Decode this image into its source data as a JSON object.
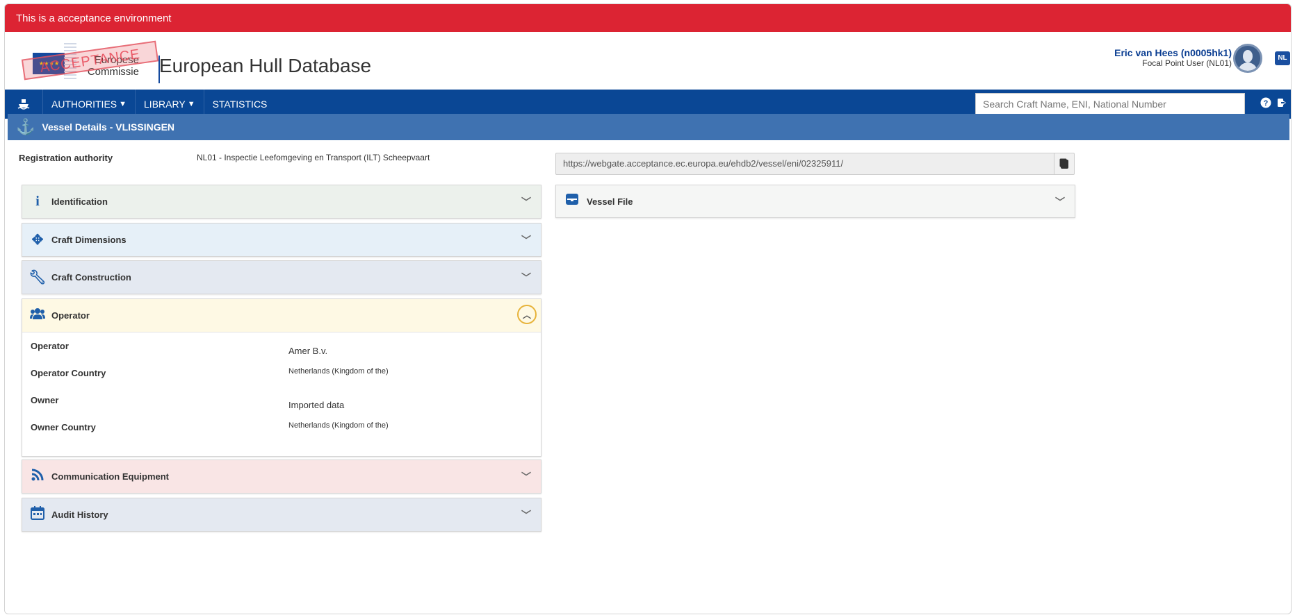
{
  "env_banner": "This is a acceptance environment",
  "header": {
    "logo_line1": "Europese",
    "logo_line2": "Commissie",
    "stamp": "ACCEPTANCE",
    "site_title": "European Hull Database",
    "user_name": "Eric van Hees (n0005hk1)",
    "user_role": "Focal Point User (NL01)",
    "lang": "NL"
  },
  "nav": {
    "home_icon": "ship-icon",
    "items": [
      {
        "label": "AUTHORITIES",
        "dropdown": true
      },
      {
        "label": "LIBRARY",
        "dropdown": true
      },
      {
        "label": "STATISTICS",
        "dropdown": false
      }
    ],
    "search_placeholder": "Search Craft Name, ENI, National Number",
    "help_icon": "help-icon",
    "logout_icon": "logout-icon"
  },
  "panel": {
    "title": "Vessel Details - VLISSINGEN",
    "icon": "anchor-icon"
  },
  "registration": {
    "label": "Registration authority",
    "value": "NL01 - Inspectie Leefomgeving en Transport (ILT) Scheepvaart"
  },
  "url": "https://webgate.acceptance.ec.europa.eu/ehdb2/vessel/eni/02325911/",
  "sections": {
    "identification": {
      "title": "Identification",
      "icon": "info-icon"
    },
    "dimensions": {
      "title": "Craft Dimensions",
      "icon": "arrows-icon"
    },
    "construction": {
      "title": "Craft Construction",
      "icon": "wrench-icon"
    },
    "operator": {
      "title": "Operator",
      "icon": "users-icon",
      "fields": [
        {
          "label": "Operator",
          "value": "Amer B.v."
        },
        {
          "label": "Operator Country",
          "value": "Netherlands (Kingdom of the)"
        },
        {
          "label": "Owner",
          "value": "Imported data"
        },
        {
          "label": "Owner Country",
          "value": "Netherlands (Kingdom of the)"
        }
      ]
    },
    "communication": {
      "title": "Communication Equipment",
      "icon": "rss-icon"
    },
    "audit": {
      "title": "Audit History",
      "icon": "calendar-icon"
    },
    "vessel_file": {
      "title": "Vessel File",
      "icon": "folder-icon"
    }
  },
  "colors": {
    "env_banner": "#dc2433",
    "navbar": "#0a4795",
    "panel_head": "#3f72b1",
    "identification_bg": "#ecf1ec",
    "dimensions_bg": "#e6f0f8",
    "construction_bg": "#e4e9f1",
    "operator_bg": "#fef9e4",
    "communication_bg": "#f9e5e5",
    "audit_bg": "#e4e9f1"
  }
}
